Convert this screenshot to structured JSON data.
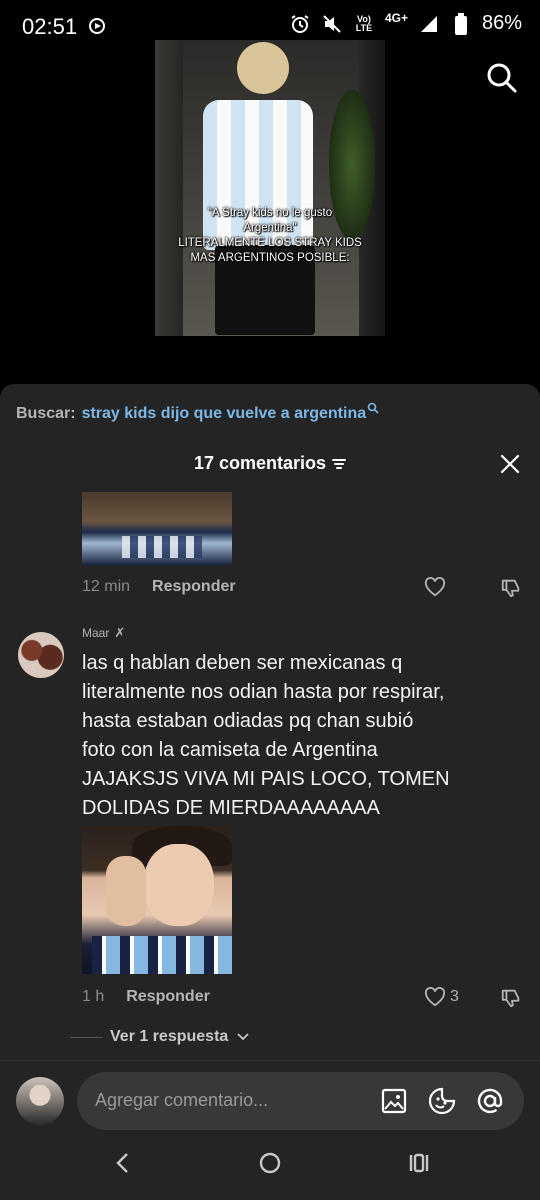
{
  "status_bar": {
    "time": "02:51",
    "network_top": "Vo)",
    "network_bottom": "LTE",
    "network_4g": "4G+",
    "battery": "86%"
  },
  "video": {
    "caption_line1": "\"A Stray kids no le gusto",
    "caption_line2": "Argentina\"",
    "caption_line3": "LITERALMENTE LOS STRAY KIDS",
    "caption_line4": "MAS ARGENTINOS POSIBLE:"
  },
  "search": {
    "label": "Buscar:",
    "query": "stray kids dijo que vuelve a argentina"
  },
  "comments": {
    "header": "17 comentarios",
    "prev_comment": {
      "time": "12 min",
      "reply_label": "Responder"
    },
    "main_comment": {
      "username": "Maar",
      "text_lines": [
        "las q hablan deben ser mexicanas q",
        "literalmente nos odian hasta por respirar,",
        "hasta estaban odiadas pq chan subió",
        "foto con la camiseta de Argentina",
        "JAJAKSJS VIVA MI PAIS LOCO, TOMEN",
        "DOLIDAS DE MIERDAAAAAAAA"
      ],
      "time": "1 h",
      "reply_label": "Responder",
      "like_count": "3"
    },
    "view_replies": "Ver 1 respuesta"
  },
  "input": {
    "placeholder": "Agregar comentario..."
  },
  "colors": {
    "accent_link": "#7db9e8",
    "panel_bg": "#242424",
    "input_bg": "#383838"
  }
}
